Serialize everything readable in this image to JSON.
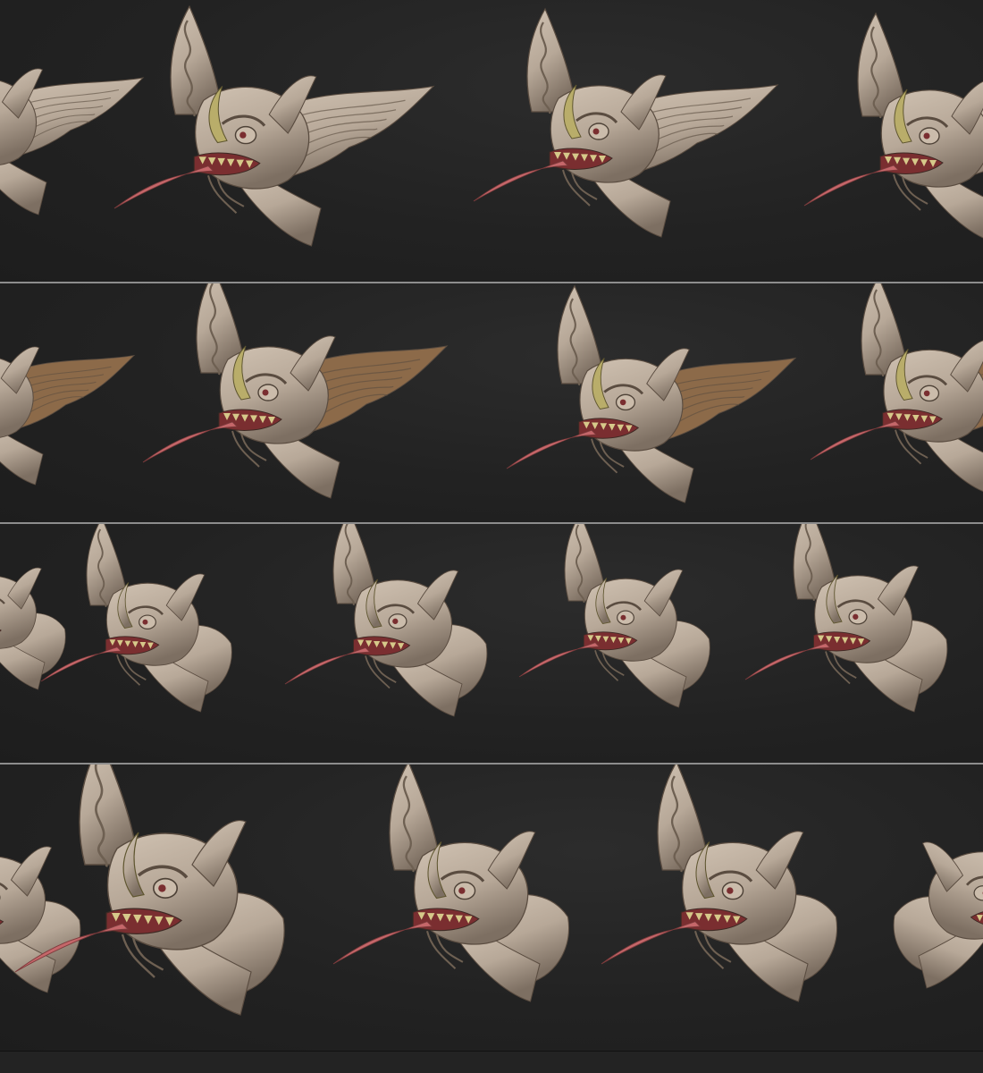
{
  "sheet": {
    "colors": {
      "background": "#232323",
      "divider": "#8d8d8d",
      "skin": "#b7a898",
      "skin_shadow": "#7d6f62",
      "horn": "#b9ad6a",
      "tongue": "#c5676a",
      "mouth": "#7a2e30",
      "teeth": "#d6c98a",
      "hair_brown": "#8c6a49"
    },
    "rows": [
      {
        "variant": "clay-with-color-accents",
        "busts": [
          {
            "icon": "giant-head-bust-icon",
            "hair": "clay-flowing",
            "view": "three-quarter",
            "cropped": "left"
          },
          {
            "icon": "giant-head-bust-icon",
            "hair": "clay-flowing",
            "view": "side"
          },
          {
            "icon": "giant-head-bust-icon",
            "hair": "clay-flowing",
            "view": "three-quarter"
          },
          {
            "icon": "giant-head-bust-icon",
            "hair": "clay-flowing",
            "view": "front-quarter",
            "cropped": "right"
          }
        ]
      },
      {
        "variant": "brown-hair",
        "busts": [
          {
            "icon": "giant-head-bust-icon",
            "hair": "brown",
            "view": "three-quarter",
            "cropped": "left"
          },
          {
            "icon": "giant-head-bust-icon",
            "hair": "brown",
            "view": "side"
          },
          {
            "icon": "giant-head-bust-icon",
            "hair": "brown",
            "view": "three-quarter"
          },
          {
            "icon": "giant-head-bust-icon",
            "hair": "brown",
            "view": "front-quarter",
            "cropped": "right"
          }
        ]
      },
      {
        "variant": "clay-only",
        "busts": [
          {
            "icon": "giant-head-bust-icon",
            "view": "side",
            "cropped": "left"
          },
          {
            "icon": "giant-head-bust-icon",
            "view": "back-quarter"
          },
          {
            "icon": "giant-head-bust-icon",
            "view": "side"
          },
          {
            "icon": "giant-head-bust-icon",
            "view": "front"
          },
          {
            "icon": "giant-head-bust-icon",
            "view": "three-quarter"
          }
        ]
      },
      {
        "variant": "clay-only-closeup",
        "busts": [
          {
            "icon": "giant-head-bust-icon",
            "view": "side",
            "cropped": "left"
          },
          {
            "icon": "giant-head-bust-icon",
            "view": "front-quarter"
          },
          {
            "icon": "giant-head-bust-icon",
            "view": "three-quarter"
          },
          {
            "icon": "giant-head-bust-icon",
            "view": "side"
          },
          {
            "icon": "giant-head-bust-icon",
            "view": "back",
            "cropped": "right"
          }
        ]
      }
    ]
  }
}
